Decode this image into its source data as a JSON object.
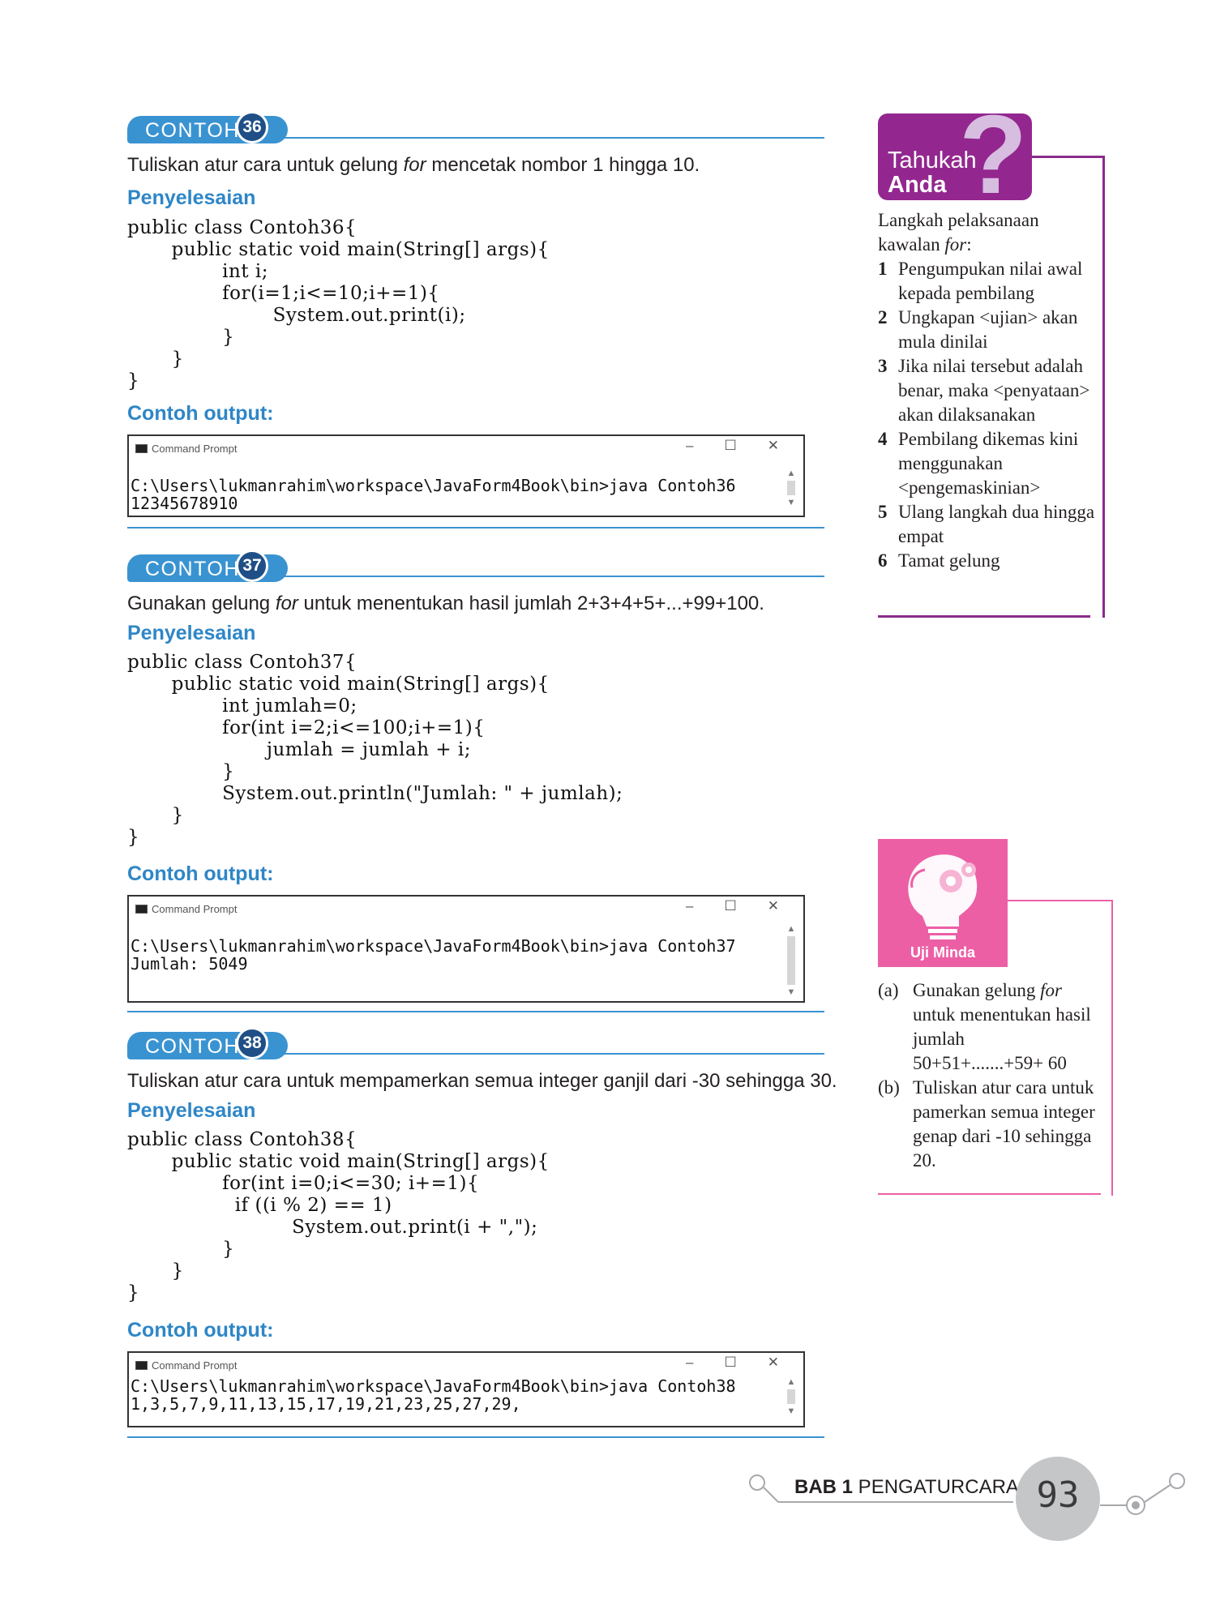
{
  "examples": [
    {
      "label": "CONTOH",
      "number": "36",
      "question_pre": "Tuliskan atur cara untuk gelung ",
      "question_em": "for",
      "question_post": " mencetak nombor 1 hingga 10.",
      "solution_label": "Penyelesaian",
      "code": "public class Contoh36{\n       public static void main(String[] args){\n               int i;\n               for(i=1;i<=10;i+=1){\n                       System.out.print(i);\n               }\n       }\n}",
      "output_label": "Contoh output:",
      "window_title": "Command Prompt",
      "console": "C:\\Users\\lukmanrahim\\workspace\\JavaForm4Book\\bin>java Contoh36\n12345678910"
    },
    {
      "label": "CONTOH",
      "number": "37",
      "question_pre": "Gunakan gelung ",
      "question_em": "for",
      "question_post": " untuk menentukan hasil jumlah 2+3+4+5+...+99+100.",
      "solution_label": "Penyelesaian",
      "code": "public class Contoh37{\n       public static void main(String[] args){\n               int jumlah=0;\n               for(int i=2;i<=100;i+=1){\n                      jumlah = jumlah + i;\n               }\n               System.out.println(\"Jumlah: \" + jumlah);\n       }\n}",
      "output_label": "Contoh output:",
      "window_title": "Command Prompt",
      "console": "C:\\Users\\lukmanrahim\\workspace\\JavaForm4Book\\bin>java Contoh37\nJumlah: 5049"
    },
    {
      "label": "CONTOH",
      "number": "38",
      "question_pre": "Tuliskan atur cara untuk mempamerkan semua integer ganjil dari -30 sehingga 30.",
      "question_em": "",
      "question_post": "",
      "solution_label": "Penyelesaian",
      "code": "public class Contoh38{\n       public static void main(String[] args){\n               for(int i=0;i<=30; i+=1){\n                 if ((i % 2) == 1)\n                          System.out.print(i + \",\");\n               }\n       }\n}",
      "output_label": "Contoh output:",
      "window_title": "Command Prompt",
      "console": "C:\\Users\\lukmanrahim\\workspace\\JavaForm4Book\\bin>java Contoh38\n1,3,5,7,9,11,13,15,17,19,21,23,25,27,29,"
    }
  ],
  "window_buttons": {
    "minimize": "–",
    "maximize": "☐",
    "close": "✕"
  },
  "tahukah": {
    "title1": "Tahukah",
    "title2": "Anda",
    "qmark": "?",
    "intro_pre": "Langkah pelaksanaan kawalan ",
    "intro_em": "for",
    "intro_post": ":",
    "steps": [
      {
        "n": "1",
        "text": "Pengumpukan nilai awal kepada pembilang"
      },
      {
        "n": "2",
        "text": "Ungkapan <ujian> akan mula dinilai"
      },
      {
        "n": "3",
        "text": "Jika nilai tersebut adalah benar, maka <penyataan> akan dilaksanakan"
      },
      {
        "n": "4",
        "text": "Pembilang dikemas kini menggunakan <pengemaskinian>"
      },
      {
        "n": "5",
        "text": "Ulang langkah dua hingga empat"
      },
      {
        "n": "6",
        "text": "Tamat gelung"
      }
    ]
  },
  "uji_minda": {
    "label": "Uji Minda",
    "a_marker": "(a)",
    "a_pre": "Gunakan gelung ",
    "a_em": "for",
    "a_post": " untuk menentukan hasil jumlah 50+51+.......+59+ 60",
    "b_marker": "(b)",
    "b_text": "Tuliskan atur cara untuk pamerkan semua integer genap dari -10 sehingga 20."
  },
  "footer": {
    "chapter_bold": "BAB 1",
    "chapter_text": " PENGATURCARAAN",
    "page_number": "93"
  },
  "colors": {
    "blue": "#3a93d1",
    "navy": "#1f4f86",
    "purple": "#93278f",
    "pink": "#ec5fa5",
    "grey": "#c5c6c8"
  }
}
